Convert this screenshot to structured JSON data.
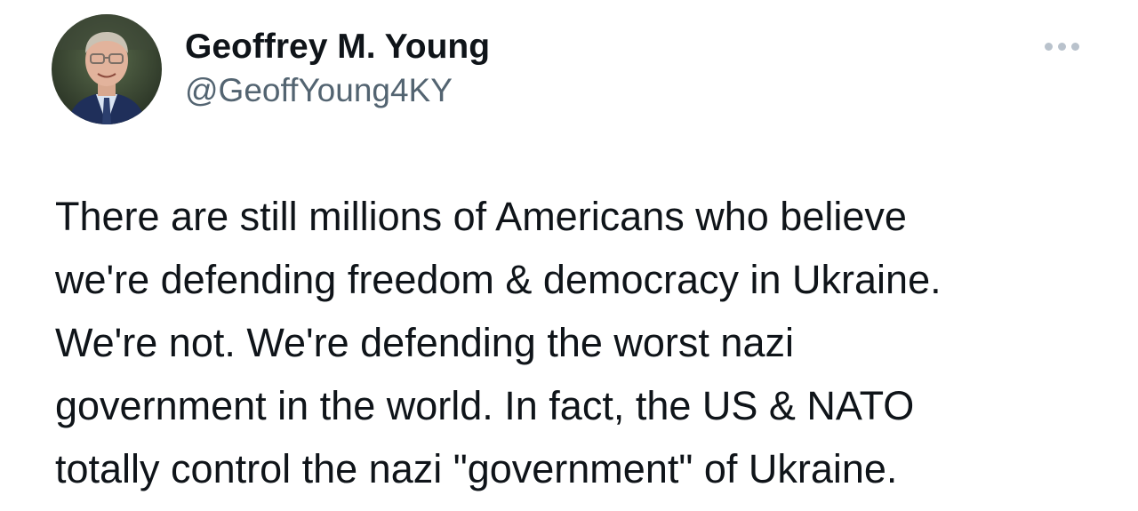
{
  "author": {
    "display_name": "Geoffrey M. Young",
    "handle": "@GeoffYoung4KY"
  },
  "more_menu": {
    "icon": "more-horizontal-icon"
  },
  "tweet": {
    "lines": [
      "There are still millions of Americans who believe",
      "we're defending freedom & democracy in Ukraine.",
      "We're not. We're defending the worst nazi",
      "government in the world. In fact, the US & NATO",
      "totally control the nazi \"government\" of Ukraine."
    ]
  },
  "colors": {
    "text": "#0f1419",
    "handle": "#536471",
    "more_dots": "#b9c2cc",
    "background": "#ffffff"
  }
}
